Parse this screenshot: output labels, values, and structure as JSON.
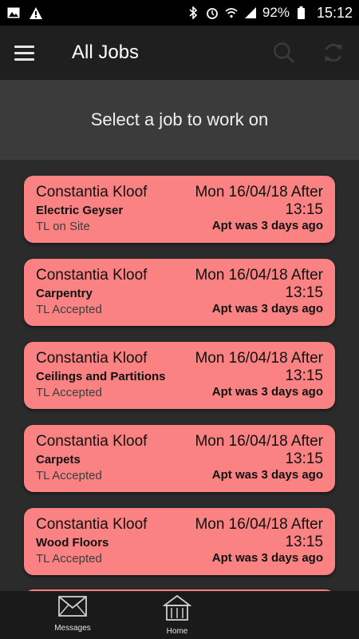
{
  "status_bar": {
    "battery": "92%",
    "time": "15:12",
    "icons": [
      "image-icon",
      "alert-icon",
      "bluetooth-icon",
      "alarm-icon",
      "wifi-icon",
      "signal-icon",
      "battery-icon"
    ]
  },
  "app_bar": {
    "title": "All Jobs",
    "menu_icon": "hamburger-menu-icon",
    "search_icon": "search-icon",
    "refresh_icon": "refresh-icon"
  },
  "subheader": {
    "text": "Select a job to work on"
  },
  "jobs": [
    {
      "site": "Constantia Kloof",
      "date": "Mon 16/04/18 After 13:15",
      "trade": "Electric Geyser",
      "status": "TL on Site",
      "ago": "Apt was 3 days ago"
    },
    {
      "site": "Constantia Kloof",
      "date": "Mon 16/04/18 After 13:15",
      "trade": "Carpentry",
      "status": "TL Accepted",
      "ago": "Apt was 3 days ago"
    },
    {
      "site": "Constantia Kloof",
      "date": "Mon 16/04/18 After 13:15",
      "trade": "Ceilings and Partitions",
      "status": "TL Accepted",
      "ago": "Apt was 3 days ago"
    },
    {
      "site": "Constantia Kloof",
      "date": "Mon 16/04/18 After 13:15",
      "trade": "Carpets",
      "status": "TL Accepted",
      "ago": "Apt was 3 days ago"
    },
    {
      "site": "Constantia Kloof",
      "date": "Mon 16/04/18 After 13:15",
      "trade": "Wood Floors",
      "status": "TL Accepted",
      "ago": "Apt was 3 days ago"
    }
  ],
  "bottom_nav": [
    {
      "label": "Messages",
      "icon": "envelope-icon"
    },
    {
      "label": "Home",
      "icon": "home-icon"
    }
  ],
  "colors": {
    "card": "#fb8282",
    "background": "#2b2b2b",
    "app_bar": "#1f1f1f",
    "subheader": "#3b3b3b"
  }
}
